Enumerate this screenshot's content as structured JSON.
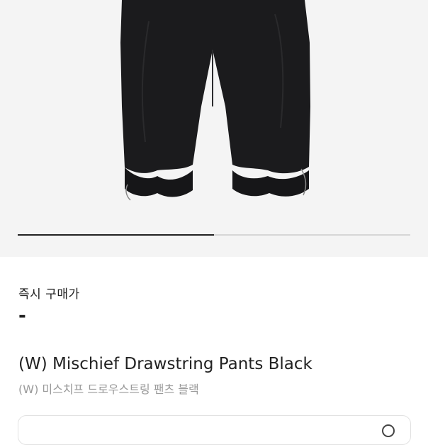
{
  "product_image": {
    "carousel_progress": 0.5
  },
  "price": {
    "label": "즉시 구매가",
    "value": "-"
  },
  "product": {
    "title": "(W) Mischief Drawstring Pants Black",
    "subtitle": "(W) 미스치프 드로우스트링 팬츠 블랙"
  },
  "icons": {
    "option": "circle-icon"
  }
}
